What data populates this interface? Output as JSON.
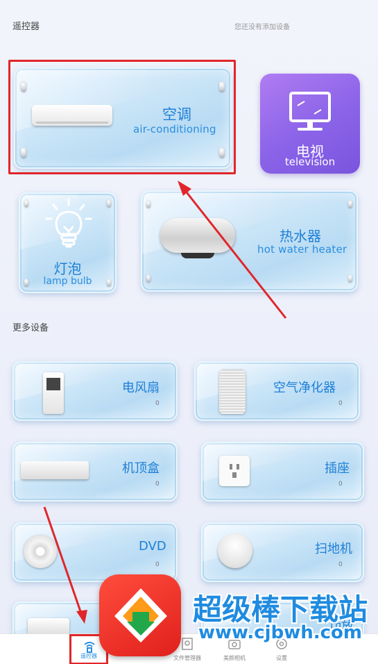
{
  "header": {
    "section_title": "遥控器",
    "hint": "您还没有添加设备"
  },
  "main_devices": [
    {
      "id": "ac",
      "title": "空调",
      "subtitle": "air-conditioning"
    },
    {
      "id": "tv",
      "title": "电视",
      "subtitle": "television"
    },
    {
      "id": "lamp",
      "title": "灯泡",
      "subtitle": "lamp bulb"
    },
    {
      "id": "heater",
      "title": "热水器",
      "subtitle": "hot water heater"
    }
  ],
  "more": {
    "section_title": "更多设备",
    "items": [
      {
        "title": "电风扇",
        "count": "0"
      },
      {
        "title": "空气净化器",
        "count": "0"
      },
      {
        "title": "机顶盒",
        "count": "0"
      },
      {
        "title": "插座",
        "count": "0"
      },
      {
        "title": "DVD",
        "count": "0"
      },
      {
        "title": "扫地机",
        "count": "0"
      },
      {
        "title": "功放",
        "count": ""
      }
    ]
  },
  "bottom_nav": {
    "items": [
      {
        "label": "遥控器",
        "icon": "wifi-remote-icon",
        "active": true
      },
      {
        "label": "文件管理器",
        "icon": "file-search-icon",
        "active": false
      },
      {
        "label": "美颜相机",
        "icon": "camera-icon",
        "active": false
      },
      {
        "label": "设置",
        "icon": "gear-icon",
        "active": false
      }
    ]
  },
  "watermark": {
    "title": "超级棒下载站",
    "url": "www.cjbwh.com"
  },
  "colors": {
    "accent": "#1e7fd6",
    "highlight": "#e0262a",
    "tv_card": "#8a63e8"
  }
}
